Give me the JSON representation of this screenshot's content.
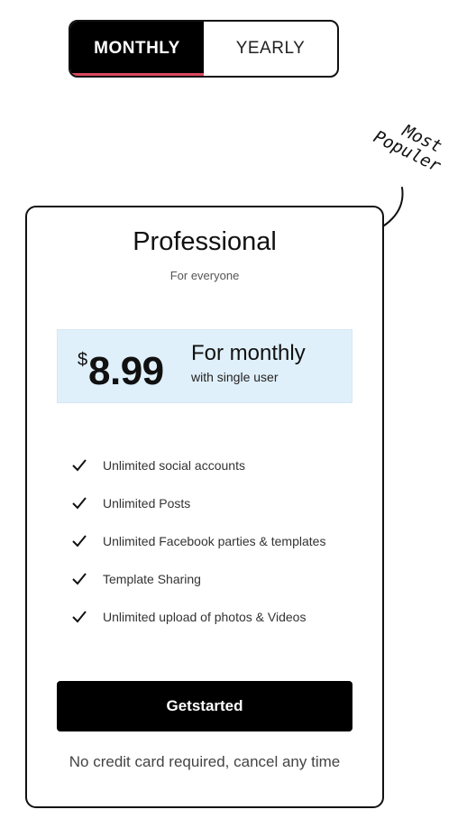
{
  "billing_toggle": {
    "options": [
      {
        "label": "MONTHLY",
        "active": true
      },
      {
        "label": "YEARLY",
        "active": false
      }
    ]
  },
  "badge": {
    "line1": "Most",
    "line2": "Populer"
  },
  "card": {
    "title": "Professional",
    "subtitle": "For everyone",
    "price": {
      "currency": "$",
      "amount": "8.99",
      "period": "For monthly",
      "users": "with single user"
    },
    "features": [
      "Unlimited social accounts",
      "Unlimited Posts",
      "Unlimited Facebook parties & templates",
      "Template Sharing",
      "Unlimited upload of photos & Videos"
    ],
    "cta_label": "Getstarted",
    "note": "No credit card required, cancel any time"
  },
  "colors": {
    "toggle_active_bg": "#000000",
    "toggle_active_underline": "#d9485f",
    "price_box_bg": "#e0f0fa",
    "cta_bg": "#000000"
  }
}
